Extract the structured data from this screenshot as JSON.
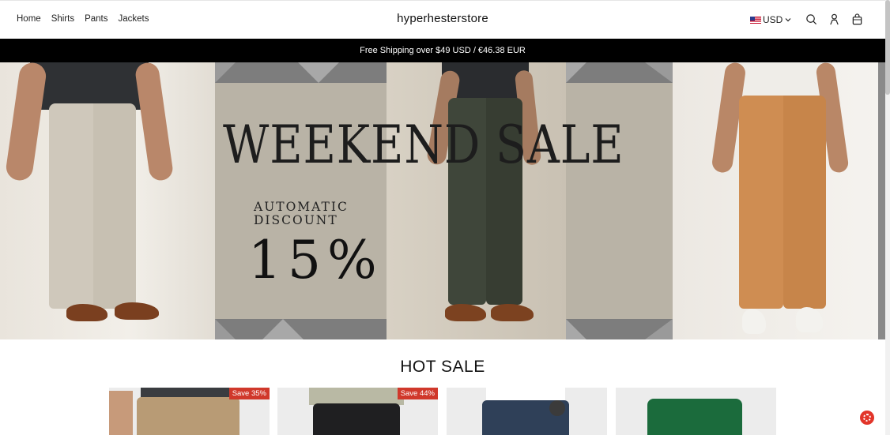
{
  "header": {
    "nav": [
      "Home",
      "Shirts",
      "Pants",
      "Jackets"
    ],
    "brand": "hyperhesterstore",
    "currency": "USD",
    "icons": [
      "search-icon",
      "account-icon",
      "cart-icon"
    ]
  },
  "announcement": "Free Shipping over $49 USD / €46.38 EUR",
  "hero": {
    "title": "WEEKEND SALE",
    "line1": "AUTOMATIC",
    "line2": "DISCOUNT",
    "percent": "15%"
  },
  "section": {
    "title": "HOT SALE",
    "products": [
      {
        "badge": "Save 35%"
      },
      {
        "badge": "Save 44%"
      },
      {
        "badge": ""
      },
      {
        "badge": ""
      }
    ]
  },
  "colors": {
    "announcement_bg": "#000000",
    "badge": "#d0382b",
    "help_button": "#e2352a"
  }
}
